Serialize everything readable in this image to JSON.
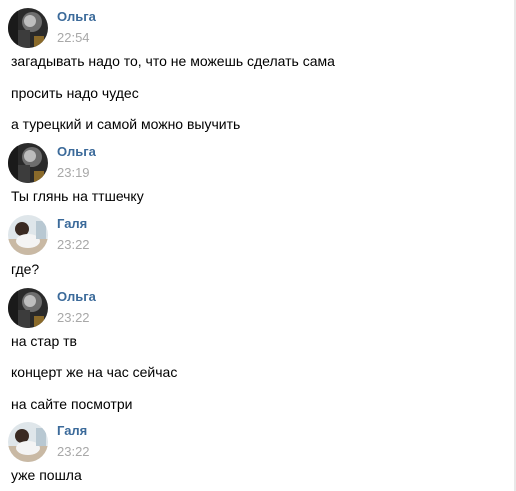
{
  "groups": [
    {
      "author": "Ольга",
      "time": "22:54",
      "avatar_icon": "olga-avatar",
      "messages": [
        "загадывать надо то, что не можешь сделать сама",
        "просить надо чудес",
        "а турецкий и самой можно выучить"
      ]
    },
    {
      "author": "Ольга",
      "time": "23:19",
      "avatar_icon": "olga-avatar",
      "messages": [
        "Ты глянь на ттшечку"
      ]
    },
    {
      "author": "Галя",
      "time": "23:22",
      "avatar_icon": "galya-avatar",
      "messages": [
        "где?"
      ]
    },
    {
      "author": "Ольга",
      "time": "23:22",
      "avatar_icon": "olga-avatar",
      "messages": [
        "на стар тв",
        "концерт же на час сейчас",
        "на сайте посмотри"
      ]
    },
    {
      "author": "Галя",
      "time": "23:22",
      "avatar_icon": "galya-avatar",
      "messages": [
        "уже пошла"
      ]
    }
  ],
  "colors": {
    "author_name": "#3b6a9a",
    "timestamp": "#a8a8a8",
    "message_text": "#000000",
    "background": "#ffffff"
  }
}
